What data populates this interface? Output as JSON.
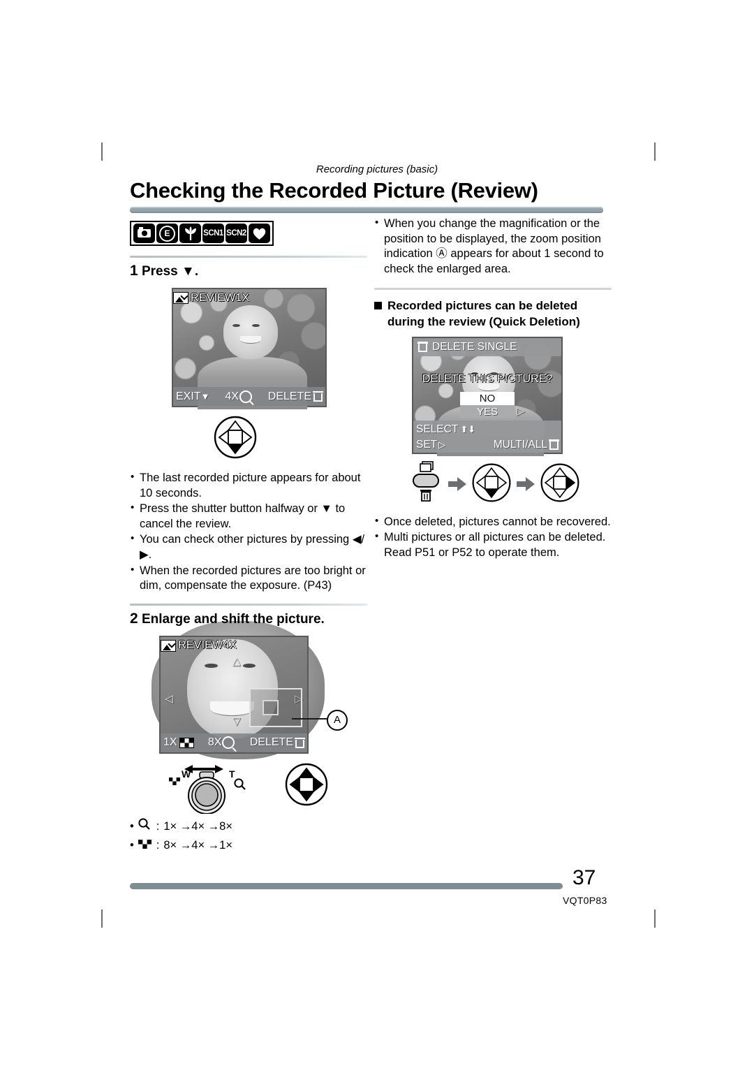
{
  "document": {
    "kicker": "Recording pictures (basic)",
    "title": "Checking the Recorded Picture (Review)",
    "page_number": "37",
    "doc_code": "VQT0P83"
  },
  "mode_icons": [
    {
      "name": "normal-picture-mode-icon",
      "label": ""
    },
    {
      "name": "economy-mode-icon",
      "label": "E"
    },
    {
      "name": "macro-mode-icon",
      "label": ""
    },
    {
      "name": "scene-mode-1-icon",
      "label": "SCN1"
    },
    {
      "name": "scene-mode-2-icon",
      "label": "SCN2"
    },
    {
      "name": "heart-mode-icon",
      "label": ""
    }
  ],
  "left_column": {
    "step1": {
      "number": "1",
      "text": "Press ▼."
    },
    "lcd_review_1x": {
      "osd_label": "REVIEW1X",
      "exit_label": "EXIT",
      "exit_arrow": "▼",
      "zoom_label": "4X",
      "delete_label": "DELETE"
    },
    "bullets": [
      "The last recorded picture appears for about 10 seconds.",
      "Press the shutter button halfway or ▼ to cancel the review.",
      "You can check other pictures by pressing ◀/▶.",
      "When the recorded pictures are too bright or dim, compensate the exposure. (P43)"
    ],
    "step2": {
      "number": "2",
      "text": "Enlarge and shift the picture."
    },
    "lcd_review_4x": {
      "osd_label": "REVIEW4X",
      "zoom_out_label": "1X",
      "zoom_in_label": "8X",
      "delete_label": "DELETE",
      "callout_label": "A"
    },
    "lever": {
      "wide_label": "W",
      "tele_label": "T"
    },
    "legend": [
      {
        "icon": "magnify-icon",
        "sequence": "1× →4× →8×"
      },
      {
        "icon": "multi-view-icon",
        "sequence": "8× →4× →1×"
      }
    ]
  },
  "right_column": {
    "top_bullet": "When you change the magnification or the position to be displayed, the zoom position indication Ⓐ appears for about 1 second to check the enlarged area.",
    "subhead": "Recorded pictures can be deleted during the review (Quick Deletion)",
    "lcd_delete": {
      "menu_title": "DELETE SINGLE",
      "question": "DELETE THIS PICTURE?",
      "option_no": "NO",
      "option_yes": "YES",
      "select_label": "SELECT",
      "set_label": "SET",
      "multi_all_label": "MULTI/ALL"
    },
    "bullets": [
      "Once deleted, pictures cannot be recovered.",
      "Multi pictures or all pictures can be deleted. Read P51 or P52 to operate them."
    ]
  },
  "colors": {
    "rule": "#93a3a9",
    "foot_rule": "#7e8e94",
    "lcd_border": "#58595b"
  }
}
